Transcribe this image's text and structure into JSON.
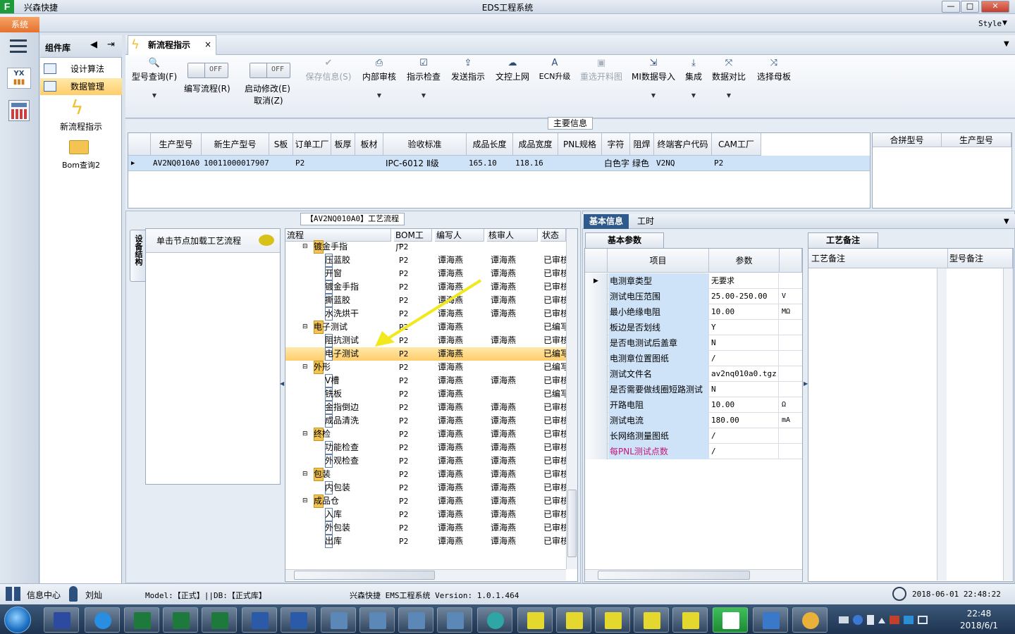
{
  "window": {
    "app_name": "兴森快捷",
    "title": "EDS工程系统",
    "menu_tab": "系统",
    "style_label": "Style",
    "btn_min": "—",
    "btn_max": "□",
    "btn_close": "✕"
  },
  "sidebar": {
    "header": "组件库",
    "items": [
      {
        "label": "设计算法"
      },
      {
        "label": "数据管理"
      }
    ],
    "big_items": [
      {
        "label": "新流程指示"
      },
      {
        "label": "Bom查询2"
      }
    ]
  },
  "doc_tab": {
    "label": "新流程指示",
    "close": "×"
  },
  "toolbar": {
    "model_query": "型号查询(F)",
    "edit_flow_toggle": "OFF",
    "edit_flow": "编写流程(R)",
    "start_modify_toggle": "OFF",
    "start_modify": "启动修改(E)",
    "cancel": "取消(Z)",
    "save_info": "保存信息(S)",
    "internal_review": "内部审核",
    "indicator_check": "指示检查",
    "send_indicator": "发送指示",
    "doc_upload": "文控上网",
    "ecn_upgrade": "ECN升级",
    "reselect_material": "重选开料图",
    "mi_import": "MI数据导入",
    "integrate": "集成",
    "data_compare": "数据对比",
    "select_master": "选择母板"
  },
  "main_info": {
    "title": "主要信息",
    "columns": [
      "生产型号",
      "新生产型号",
      "S板",
      "订单工厂",
      "板厚",
      "板材",
      "验收标准",
      "成品长度",
      "成品宽度",
      "PNL规格",
      "字符",
      "阻焊",
      "终端客户代码",
      "CAM工厂"
    ],
    "row": [
      "AV2NQ010A0",
      "10011000017907",
      "",
      "P2",
      "",
      "",
      "IPC-6012 Ⅱ级",
      "165.10",
      "118.16",
      "",
      "白色字符",
      "绿色",
      "V2NQ",
      "P2"
    ],
    "side_columns": [
      "合拼型号",
      "生产型号"
    ]
  },
  "process_flow": {
    "title": "【AV2NQ010A0】工艺流程",
    "left_tab": "设备结构",
    "load_label": "单击节点加载工艺流程",
    "columns": [
      "流程",
      "BOM工厂",
      "编写人",
      "核审人",
      "状态"
    ],
    "rows": [
      {
        "name": "镀金手指",
        "bom": "P2",
        "writer": "",
        "reviewer": "",
        "status": "",
        "folder": true
      },
      {
        "name": "压蓝胶",
        "bom": "P2",
        "writer": "谭海燕",
        "reviewer": "谭海燕",
        "status": "已审核"
      },
      {
        "name": "开窗",
        "bom": "P2",
        "writer": "谭海燕",
        "reviewer": "谭海燕",
        "status": "已审核"
      },
      {
        "name": "镀金手指",
        "bom": "P2",
        "writer": "谭海燕",
        "reviewer": "谭海燕",
        "status": "已审核"
      },
      {
        "name": "撕蓝胶",
        "bom": "P2",
        "writer": "谭海燕",
        "reviewer": "谭海燕",
        "status": "已审核"
      },
      {
        "name": "水洗烘干",
        "bom": "P2",
        "writer": "谭海燕",
        "reviewer": "谭海燕",
        "status": "已审核"
      },
      {
        "name": "电子测试",
        "bom": "P2",
        "writer": "谭海燕",
        "reviewer": "",
        "status": "已编写",
        "folder": true
      },
      {
        "name": "阻抗测试",
        "bom": "P2",
        "writer": "谭海燕",
        "reviewer": "谭海燕",
        "status": "已审核"
      },
      {
        "name": "电子测试",
        "bom": "P2",
        "writer": "谭海燕",
        "reviewer": "",
        "status": "已编写",
        "selected": true
      },
      {
        "name": "外形",
        "bom": "P2",
        "writer": "谭海燕",
        "reviewer": "",
        "status": "已编写",
        "folder": true
      },
      {
        "name": "V槽",
        "bom": "P2",
        "writer": "谭海燕",
        "reviewer": "谭海燕",
        "status": "已审核"
      },
      {
        "name": "铣板",
        "bom": "P2",
        "writer": "谭海燕",
        "reviewer": "",
        "status": "已编写"
      },
      {
        "name": "金指倒边",
        "bom": "P2",
        "writer": "谭海燕",
        "reviewer": "谭海燕",
        "status": "已审核"
      },
      {
        "name": "成品清洗",
        "bom": "P2",
        "writer": "谭海燕",
        "reviewer": "谭海燕",
        "status": "已审核"
      },
      {
        "name": "终检",
        "bom": "P2",
        "writer": "谭海燕",
        "reviewer": "谭海燕",
        "status": "已审核",
        "folder": true
      },
      {
        "name": "功能检查",
        "bom": "P2",
        "writer": "谭海燕",
        "reviewer": "谭海燕",
        "status": "已审核"
      },
      {
        "name": "外观检查",
        "bom": "P2",
        "writer": "谭海燕",
        "reviewer": "谭海燕",
        "status": "已审核"
      },
      {
        "name": "包装",
        "bom": "P2",
        "writer": "谭海燕",
        "reviewer": "谭海燕",
        "status": "已审核",
        "folder": true
      },
      {
        "name": "内包装",
        "bom": "P2",
        "writer": "谭海燕",
        "reviewer": "谭海燕",
        "status": "已审核"
      },
      {
        "name": "成品仓",
        "bom": "P2",
        "writer": "谭海燕",
        "reviewer": "谭海燕",
        "status": "已审核",
        "folder": true
      },
      {
        "name": "入库",
        "bom": "P2",
        "writer": "谭海燕",
        "reviewer": "谭海燕",
        "status": "已审核"
      },
      {
        "name": "外包装",
        "bom": "P2",
        "writer": "谭海燕",
        "reviewer": "谭海燕",
        "status": "已审核"
      },
      {
        "name": "出库",
        "bom": "P2",
        "writer": "谭海燕",
        "reviewer": "谭海燕",
        "status": "已审核"
      }
    ]
  },
  "basic_info": {
    "tabs": [
      "基本信息",
      "工时"
    ],
    "subtab": "基本参数",
    "columns": [
      "项目",
      "参数"
    ],
    "rows": [
      {
        "item": "电测章类型",
        "value": "无要求",
        "unit": ""
      },
      {
        "item": "测试电压范围",
        "value": "25.00-250.00",
        "unit": "V"
      },
      {
        "item": "最小绝缘电阻",
        "value": "10.00",
        "unit": "MΩ"
      },
      {
        "item": "板边是否划线",
        "value": "Y",
        "unit": ""
      },
      {
        "item": "是否电测试后盖章",
        "value": "N",
        "unit": ""
      },
      {
        "item": "电测章位置图纸",
        "value": "/",
        "unit": ""
      },
      {
        "item": "测试文件名",
        "value": "av2nq010a0.tgz",
        "unit": ""
      },
      {
        "item": "是否需要做线圈短路测试",
        "value": "N",
        "unit": ""
      },
      {
        "item": "开路电阻",
        "value": "10.00",
        "unit": "Ω"
      },
      {
        "item": "测试电流",
        "value": "180.00",
        "unit": "mA"
      },
      {
        "item": "长网络测量图纸",
        "value": "/",
        "unit": ""
      },
      {
        "item": "每PNL测试点数",
        "value": "/",
        "unit": ""
      }
    ]
  },
  "process_notes": {
    "tab": "工艺备注",
    "columns": [
      "工艺备注",
      "型号备注"
    ]
  },
  "status": {
    "info_center": "信息中心",
    "user": "刘灿",
    "model": "Model:【正式】||DB:【正式库】",
    "version": "兴森快捷 EMS工程系统 Version: 1.0.1.464",
    "datetime": "2018-06-01 22:48:22"
  },
  "taskbar": {
    "time": "22:48",
    "date": "2018/6/1"
  },
  "colors": {
    "accent_orange": "#e5722c",
    "selection": "#ffcd6b",
    "row_highlight": "#cfe3f8",
    "header_blue": "#2f5a8c"
  }
}
